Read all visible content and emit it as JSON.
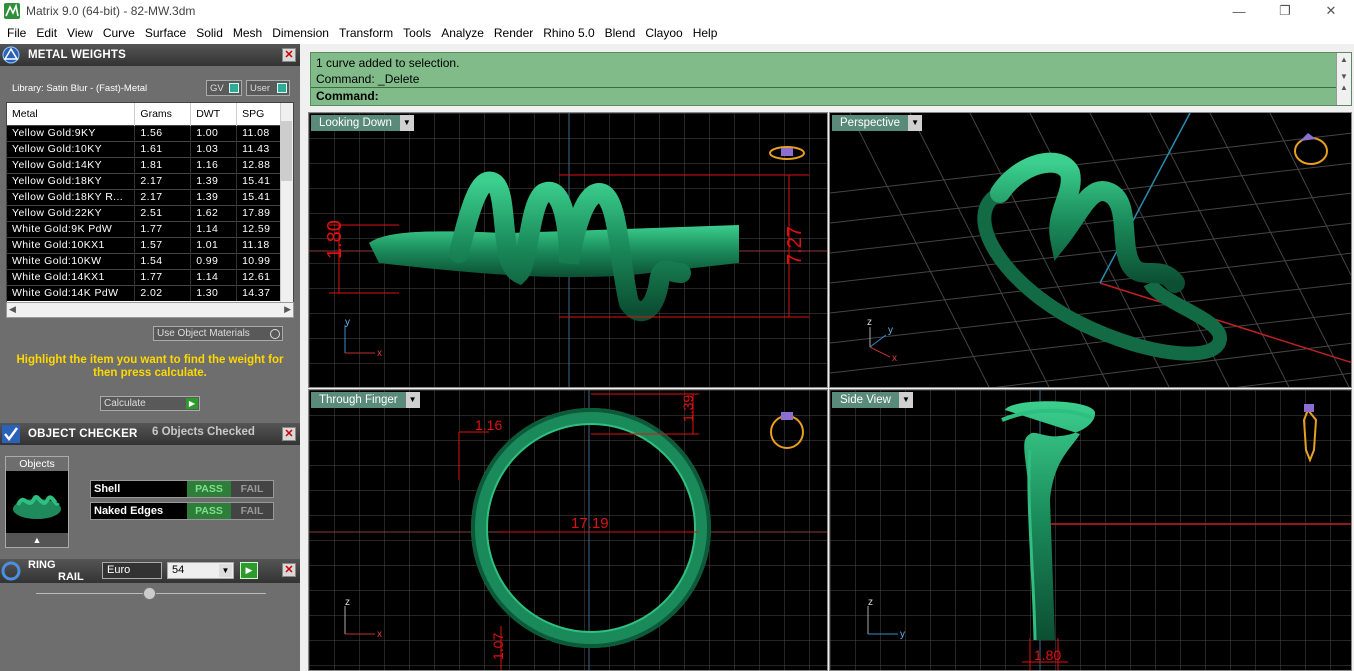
{
  "window": {
    "title": "Matrix 9.0 (64-bit) - 82-MW.3dm",
    "min": "—",
    "max": "❐",
    "close": "✕"
  },
  "menu": [
    "File",
    "Edit",
    "View",
    "Curve",
    "Surface",
    "Solid",
    "Mesh",
    "Dimension",
    "Transform",
    "Tools",
    "Analyze",
    "Render",
    "Rhino 5.0",
    "Blend",
    "Clayoo",
    "Help"
  ],
  "metal_weights": {
    "title": "METAL WEIGHTS",
    "library": "Library: Satin Blur - (Fast)-Metal",
    "gv_label": "GV",
    "user_label": "User",
    "columns": [
      "Metal",
      "Grams",
      "DWT",
      "SPG"
    ],
    "rows": [
      [
        "Yellow Gold:9KY",
        "1.56",
        "1.00",
        "11.08"
      ],
      [
        "Yellow Gold:10KY",
        "1.61",
        "1.03",
        "11.43"
      ],
      [
        "Yellow Gold:14KY",
        "1.81",
        "1.16",
        "12.88"
      ],
      [
        "Yellow Gold:18KY",
        "2.17",
        "1.39",
        "15.41"
      ],
      [
        "Yellow Gold:18KY R...",
        "2.17",
        "1.39",
        "15.41"
      ],
      [
        "Yellow Gold:22KY",
        "2.51",
        "1.62",
        "17.89"
      ],
      [
        "White Gold:9K PdW",
        "1.77",
        "1.14",
        "12.59"
      ],
      [
        "White Gold:10KX1",
        "1.57",
        "1.01",
        "11.18"
      ],
      [
        "White Gold:10KW",
        "1.54",
        "0.99",
        "10.99"
      ],
      [
        "White Gold:14KX1",
        "1.77",
        "1.14",
        "12.61"
      ],
      [
        "White Gold:14K PdW",
        "2.02",
        "1.30",
        "14.37"
      ]
    ],
    "use_object_materials": "Use Object Materials",
    "highlight_msg": "Highlight the item you want to find the weight for then press calculate.",
    "calculate": "Calculate"
  },
  "object_checker": {
    "title": "OBJECT CHECKER",
    "status": "6  Objects Checked",
    "objects_label": "Objects",
    "checks": [
      {
        "name": "Shell",
        "pass": "PASS",
        "fail": "FAIL"
      },
      {
        "name": "Naked Edges",
        "pass": "PASS",
        "fail": "FAIL"
      }
    ]
  },
  "ring_rail": {
    "title_1": "RING",
    "title_2": "RAIL",
    "standard": "Euro",
    "size": "54"
  },
  "command": {
    "line1": "1 curve added to selection.",
    "line2": "Command: _Delete",
    "prompt": "Command:"
  },
  "viewports": {
    "top": {
      "label": "Looking Down",
      "dim_a": "1.80",
      "dim_b": "7.27"
    },
    "persp": {
      "label": "Perspective"
    },
    "front": {
      "label": "Through Finger",
      "dim_a": "1.16",
      "dim_b": "1.39",
      "dim_c": "17.19",
      "dim_d": "1.07"
    },
    "side": {
      "label": "Side View",
      "dim_a": "1.80"
    }
  },
  "axes": {
    "x": "x",
    "y": "y",
    "z": "z"
  },
  "colors": {
    "ring_green": "#1f8a5c",
    "dim_red": "#e01010",
    "grid": "#5a5a5a",
    "cmd_bg": "#82bb8a"
  }
}
